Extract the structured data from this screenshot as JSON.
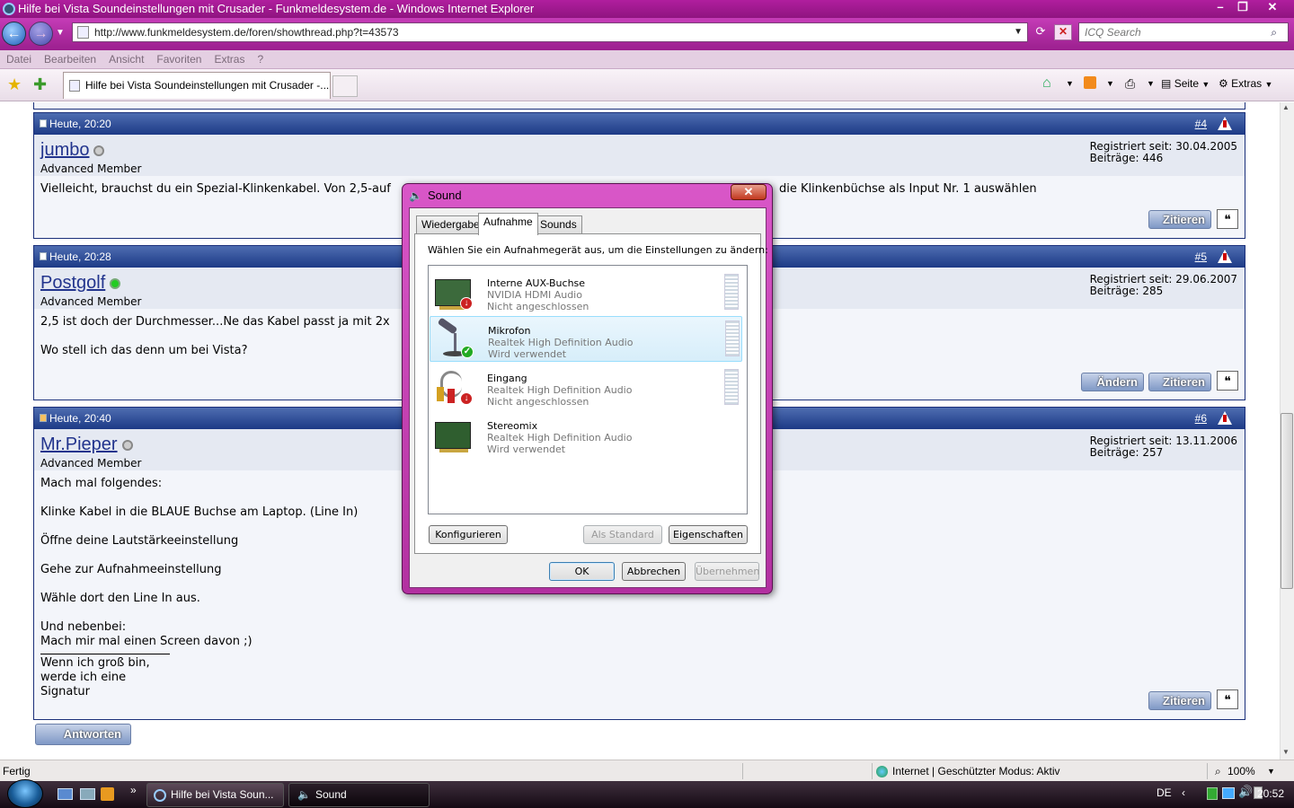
{
  "window": {
    "title": "Hilfe bei Vista Soundeinstellungen mit Crusader - Funkmeldesystem.de - Windows Internet Explorer"
  },
  "address": {
    "url": "http://www.funkmeldesystem.de/foren/showthread.php?t=43573"
  },
  "search": {
    "placeholder": "ICQ Search"
  },
  "menu": [
    "Datei",
    "Bearbeiten",
    "Ansicht",
    "Favoriten",
    "Extras",
    "?"
  ],
  "tab": {
    "title": "Hilfe bei Vista Soundeinstellungen mit Crusader -..."
  },
  "commands": {
    "page": "Seite",
    "tools": "Extras"
  },
  "posts": [
    {
      "time": "Heute, 20:20",
      "num": "4",
      "user": "jumbo",
      "user_title": "Advanced Member",
      "registered": "Registriert seit: 30.04.2005",
      "count": "Beiträge: 446",
      "text_left": "Vielleicht, brauchst du ein Spezial-Klinkenkabel. Von 2,5-auf",
      "text_right": "die Klinkenbüchse als Input Nr. 1 auswählen"
    },
    {
      "time": "Heute, 20:28",
      "num": "5",
      "user": "Postgolf",
      "user_title": "Advanced Member",
      "registered": "Registriert seit: 29.06.2007",
      "count": "Beiträge: 285",
      "lines": [
        "2,5 ist doch der Durchmesser...Ne das Kabel passt ja mit 2x",
        "Wo stell ich das denn um bei Vista?"
      ]
    },
    {
      "time": "Heute, 20:40",
      "num": "6",
      "user": "Mr.Pieper",
      "user_title": "Advanced Member",
      "registered": "Registriert seit: 13.11.2006",
      "count": "Beiträge: 257",
      "lines": [
        "Mach mal folgendes:",
        "Klinke Kabel in die BLAUE Buchse am Laptop. (Line In)",
        "Öffne deine Lautstärkeeinstellung",
        "Gehe zur Aufnahmeeinstellung",
        "Wähle dort den Line In aus.",
        "Und nebenbei:",
        "Mach mir mal einen Screen davon ;)"
      ],
      "signature": "Wenn ich groß bin, werde ich eine Signatur"
    }
  ],
  "buttons": {
    "quote": "Zitieren",
    "edit": "Ändern",
    "reply": "Antworten"
  },
  "status": {
    "left": "Fertig",
    "zone": "Internet | Geschützter Modus: Aktiv",
    "zoom": "100%"
  },
  "taskbar": {
    "ie_task": "Hilfe bei Vista Soun...",
    "sound_task": "Sound",
    "lang": "DE",
    "clock": "20:52"
  },
  "dialog": {
    "title": "Sound",
    "tabs": [
      "Wiedergabe",
      "Aufnahme",
      "Sounds"
    ],
    "instruction": "Wählen Sie ein Aufnahmegerät aus, um die Einstellungen zu ändern:",
    "devices": [
      {
        "name": "Interne AUX-Buchse",
        "driver": "NVIDIA HDMI Audio",
        "state": "Nicht angeschlossen"
      },
      {
        "name": "Mikrofon",
        "driver": "Realtek High Definition Audio",
        "state": "Wird verwendet"
      },
      {
        "name": "Eingang",
        "driver": "Realtek High Definition Audio",
        "state": "Nicht angeschlossen"
      },
      {
        "name": "Stereomix",
        "driver": "Realtek High Definition Audio",
        "state": "Wird verwendet"
      }
    ],
    "btn_configure": "Konfigurieren",
    "btn_default": "Als Standard",
    "btn_properties": "Eigenschaften",
    "btn_ok": "OK",
    "btn_cancel": "Abbrechen",
    "btn_apply": "Übernehmen"
  },
  "colors": {
    "titlebar": "#b01e9e",
    "post_header": "#1d3a86",
    "link": "#22348d"
  }
}
